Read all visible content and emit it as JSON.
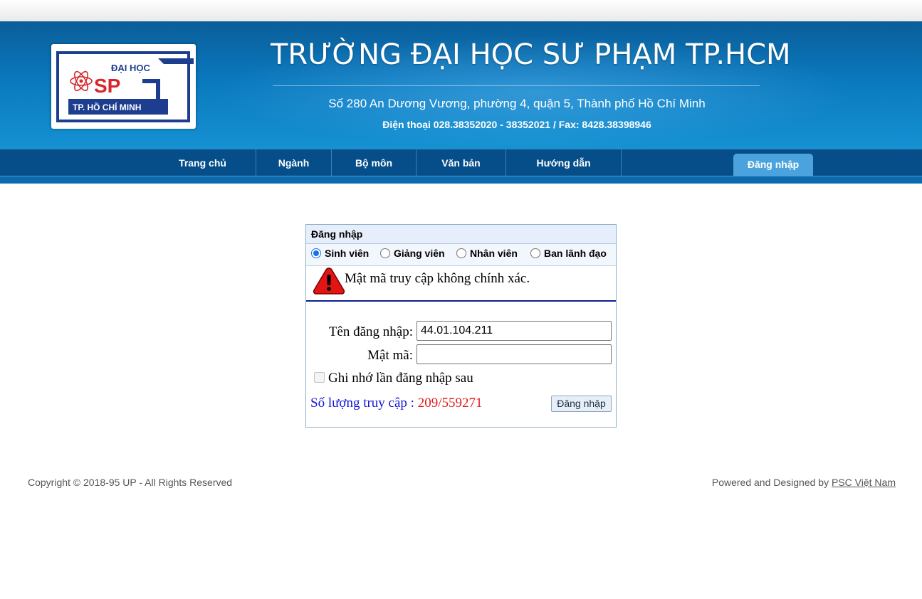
{
  "header": {
    "logo": {
      "line1": "ĐẠI HỌC",
      "line2": "SP",
      "line3": "TP. HỒ CHÍ MINH"
    },
    "title": "TRƯỜNG ĐẠI HỌC SƯ PHẠM TP.HCM",
    "address": "Số 280 An Dương Vương, phường 4, quận 5, Thành phố Hồ Chí Minh",
    "phone": "Điện thoại 028.38352020 - 38352021 / Fax: 8428.38398946"
  },
  "nav": {
    "items": [
      {
        "label": "Trang chủ"
      },
      {
        "label": "Ngành"
      },
      {
        "label": "Bộ môn"
      },
      {
        "label": "Văn bản"
      },
      {
        "label": "Hướng dẫn"
      }
    ],
    "login_tab": "Đăng nhập"
  },
  "login": {
    "title": "Đăng nhập",
    "roles": [
      {
        "label": "Sinh viên",
        "checked": true
      },
      {
        "label": "Giảng viên",
        "checked": false
      },
      {
        "label": "Nhân viên",
        "checked": false
      },
      {
        "label": "Ban lãnh đạo",
        "checked": false
      }
    ],
    "error": "Mật mã truy cập không chính xác.",
    "username_label": "Tên đăng nhập:",
    "username_value": "44.01.104.211",
    "password_label": "Mật mã:",
    "password_value": "",
    "remember_label": "Ghi nhớ lần đăng nhập sau",
    "counter_label": "Số lượng truy cập :",
    "counter_value": "209/559271",
    "submit_label": "Đăng nhập"
  },
  "footer": {
    "copyright": "Copyright © 2018-95 UP - All Rights Reserved",
    "powered_prefix": "Powered and Designed by",
    "powered_link": "PSC Việt Nam"
  },
  "colors": {
    "header_blue": "#0a78bd",
    "nav_blue": "#054e89",
    "login_tab": "#4aa3dd",
    "error_rule": "#0a1f8f",
    "counter_label": "#1414d8",
    "counter_value": "#e01b1b"
  },
  "icons": [
    "atom-logo-icon",
    "warning-icon"
  ]
}
